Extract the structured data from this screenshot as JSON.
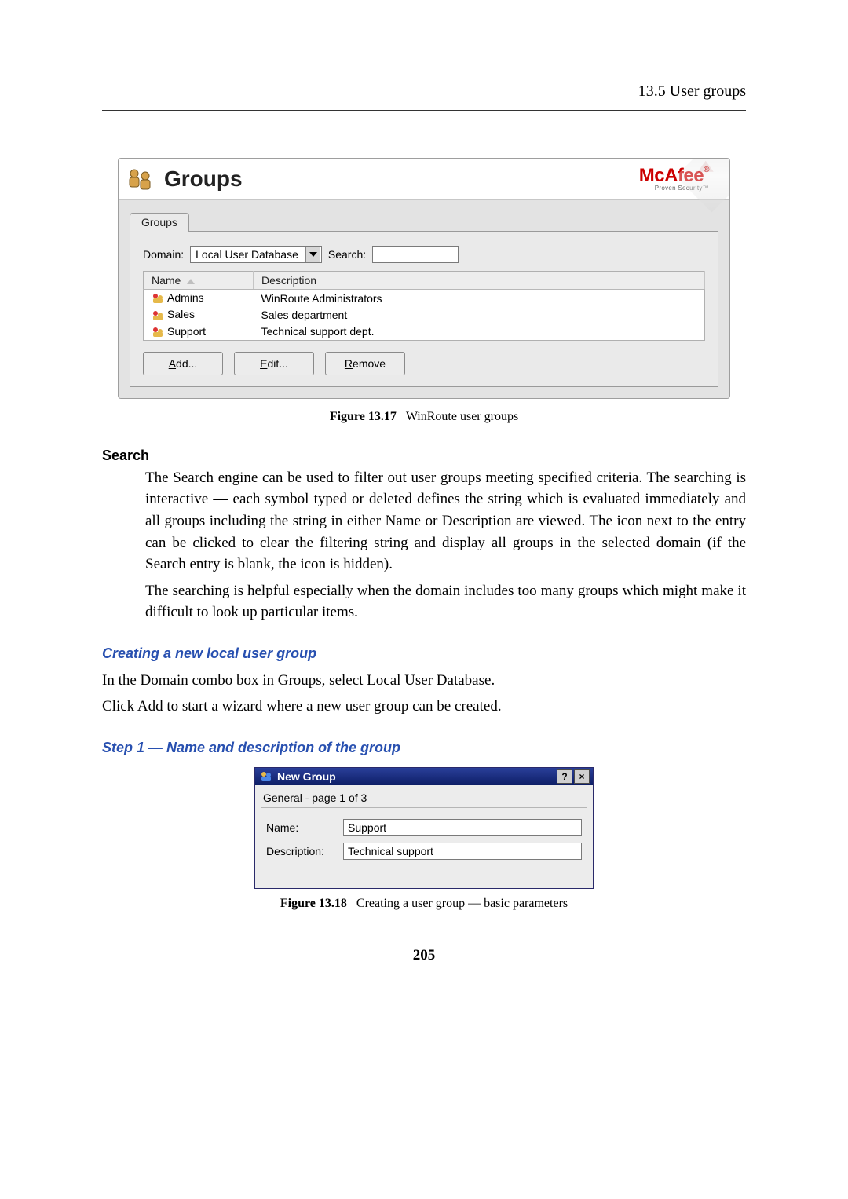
{
  "running_head": "13.5  User groups",
  "groups_window": {
    "title": "Groups",
    "brand": "McAfee",
    "brand_tagline": "Proven Security™",
    "tab_label": "Groups",
    "domain_label": "Domain:",
    "domain_value": "Local User Database",
    "search_label": "Search:",
    "columns": {
      "name": "Name",
      "description": "Description"
    },
    "rows": [
      {
        "name": "Admins",
        "description": "WinRoute Administrators"
      },
      {
        "name": "Sales",
        "description": "Sales department"
      },
      {
        "name": "Support",
        "description": "Technical support dept."
      }
    ],
    "buttons": {
      "add": "Add...",
      "edit": "Edit...",
      "remove": "Remove"
    }
  },
  "fig17_tag": "Figure 13.17",
  "fig17_caption": "WinRoute user groups",
  "search_section": {
    "heading": "Search",
    "p1": "The Search engine can be used to filter out user groups meeting specified criteria. The searching is interactive — each symbol typed or deleted defines the string which is evaluated immediately and all groups including the string in either Name or Description are viewed. The icon next to the entry can be clicked to clear the filtering string and display all groups in the selected domain (if the Search entry is blank, the icon is hidden).",
    "p2": "The searching is helpful especially when the domain includes too many groups which might make it difficult to look up particular items."
  },
  "create_section": {
    "heading": "Creating a new local user group",
    "p1": "In the Domain combo box in Groups, select Local User Database.",
    "p2": "Click Add to start a wizard where a new user group can be created."
  },
  "step1_heading": "Step 1 — Name and description of the group",
  "new_group_dialog": {
    "title": "New Group",
    "subtitle": "General - page 1 of 3",
    "name_label": "Name:",
    "name_value": "Support",
    "desc_label": "Description:",
    "desc_value": "Technical support",
    "help_btn": "?",
    "close_btn": "×"
  },
  "fig18_tag": "Figure 13.18",
  "fig18_caption": "Creating a user group — basic parameters",
  "page_number": "205"
}
